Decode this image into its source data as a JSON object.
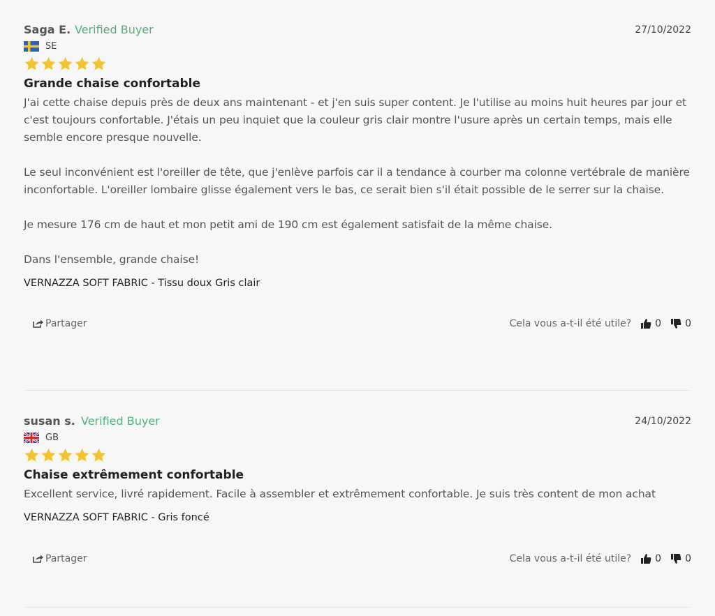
{
  "reviews": [
    {
      "author": "Saga E.",
      "verified": "Verified Buyer",
      "date": "27/10/2022",
      "country": "SE",
      "rating": 5,
      "title": "Grande chaise confortable",
      "paragraphs": [
        "J'ai cette chaise depuis près de deux ans maintenant - et j'en suis super content. Je l'utilise au moins huit heures par jour et c'est toujours confortable. J'étais un peu inquiet que la couleur gris clair montre l'usure après un certain temps, mais elle semble encore presque nouvelle.",
        "Le seul inconvénient est l'oreiller de tête, que j'enlève parfois car il a tendance à courber ma colonne vertébrale de manière inconfortable. L'oreiller lombaire glisse également vers le bas, ce serait bien s'il était possible de le serrer sur la chaise.",
        "Je mesure 176 cm de haut et mon petit ami de 190 cm est également satisfait de la même chaise.",
        "Dans l'ensemble, grande chaise!"
      ],
      "variant": "VERNAZZA SOFT FABRIC - Tissu doux Gris clair",
      "share_label": "Partager",
      "helpful_label": "Cela vous a-t-il été utile?",
      "upvotes": "0",
      "downvotes": "0"
    },
    {
      "author": "susan s.",
      "verified": "Verified Buyer",
      "date": "24/10/2022",
      "country": "GB",
      "rating": 5,
      "title": "Chaise extrêmement confortable",
      "paragraphs": [
        "Excellent service, livré rapidement. Facile à assembler et extrêmement confortable. Je suis très content de mon achat"
      ],
      "variant": "VERNAZZA SOFT FABRIC - Gris foncé",
      "share_label": "Partager",
      "helpful_label": "Cela vous a-t-il été utile?",
      "upvotes": "0",
      "downvotes": "0"
    }
  ],
  "colors": {
    "verified": "#52b07d",
    "star": "#f4c430",
    "background": "#f7f7f7"
  }
}
